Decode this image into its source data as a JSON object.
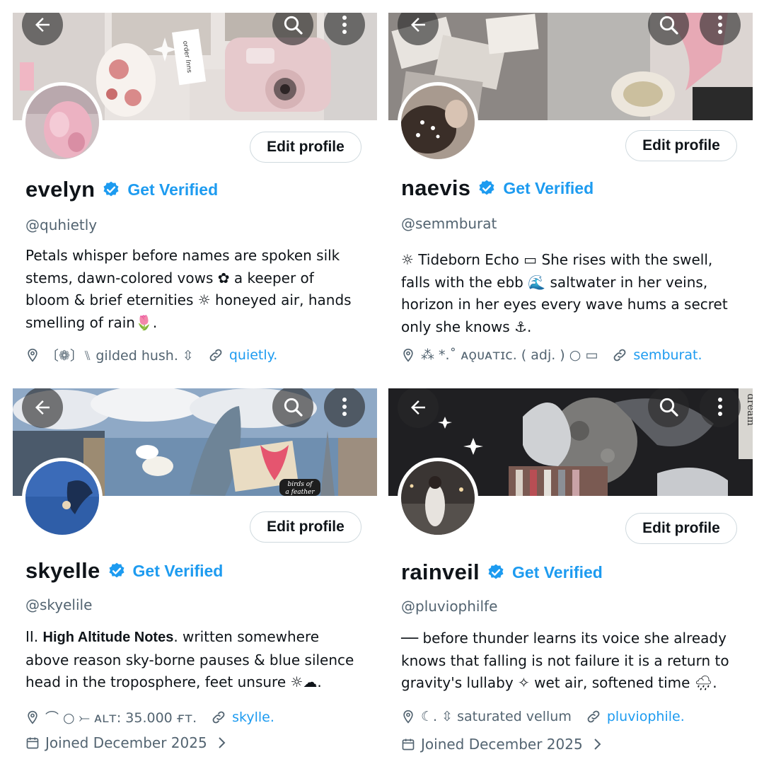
{
  "profiles": [
    {
      "display_name": "evelyn",
      "get_verified": "Get Verified",
      "handle": "@quhietly",
      "bio_lines": [
        "Petals whisper before names are spoken silk",
        "stems, dawn-colored vows ✿ a keeper of",
        "bloom & brief eternities ☼ honeyed air, hands",
        "smelling of rain🌷."
      ],
      "location": "〔❁〕⑊ gilded hush. ⇳",
      "link": "quietly.",
      "edit_profile": "Edit profile",
      "banner_stamp": "suuȷ ɹǝpɹo"
    },
    {
      "display_name": "naevis",
      "get_verified": "Get Verified",
      "handle": "@semmburat",
      "bio_lines": [
        "☼ Tideborn Echo ▭ She rises with the swell,",
        "falls with the ebb 🌊 saltwater in her veins,",
        "horizon in her eyes every wave hums a secret",
        "only she knows ⚓."
      ],
      "location": "⁂ *.˚ ᴀǫᴜᴀᴛɪᴄ. ( adj. ) ○ ▭",
      "link": "semburat.",
      "edit_profile": "Edit profile"
    },
    {
      "display_name": "skyelle",
      "get_verified": "Get Verified",
      "handle": "@skyelile",
      "bio_prefix": "II.",
      "bio_bold": "High Altitude Notes",
      "bio_rest": ". written somewhere",
      "bio_lines": [
        "above reason sky-borne pauses & blue silence",
        "head in the troposphere, feet unsure ☼☁."
      ],
      "location": "⌒ ○ ⤚ ᴀʟᴛ: 35.000 ғᴛ.",
      "link": "skylle.",
      "joined": "Joined December 2025",
      "edit_profile": "Edit profile",
      "banner_caption_1": "birds of",
      "banner_caption_2": "a feather"
    },
    {
      "display_name": "rainveil",
      "get_verified": "Get Verified",
      "handle": "@pluviophilfe",
      "bio_lines": [
        "── before thunder learns its voice she already",
        "knows that falling is not failure it is a return to",
        "gravity's lullaby ✧ wet air, softened time 🌧."
      ],
      "location": "☾. ⇳ saturated vellum",
      "link": "pluviophile.",
      "joined": "Joined December 2025",
      "edit_profile": "Edit profile",
      "banner_word": "dream"
    }
  ],
  "colors": {
    "accent": "#1d9bf0",
    "text": "#0f1419",
    "secondary": "#536471",
    "border": "#cfd9de"
  },
  "icons": [
    "back-arrow-icon",
    "search-icon",
    "more-icon",
    "verified-badge-icon",
    "location-pin-icon",
    "link-icon",
    "calendar-icon",
    "chevron-right-icon"
  ]
}
